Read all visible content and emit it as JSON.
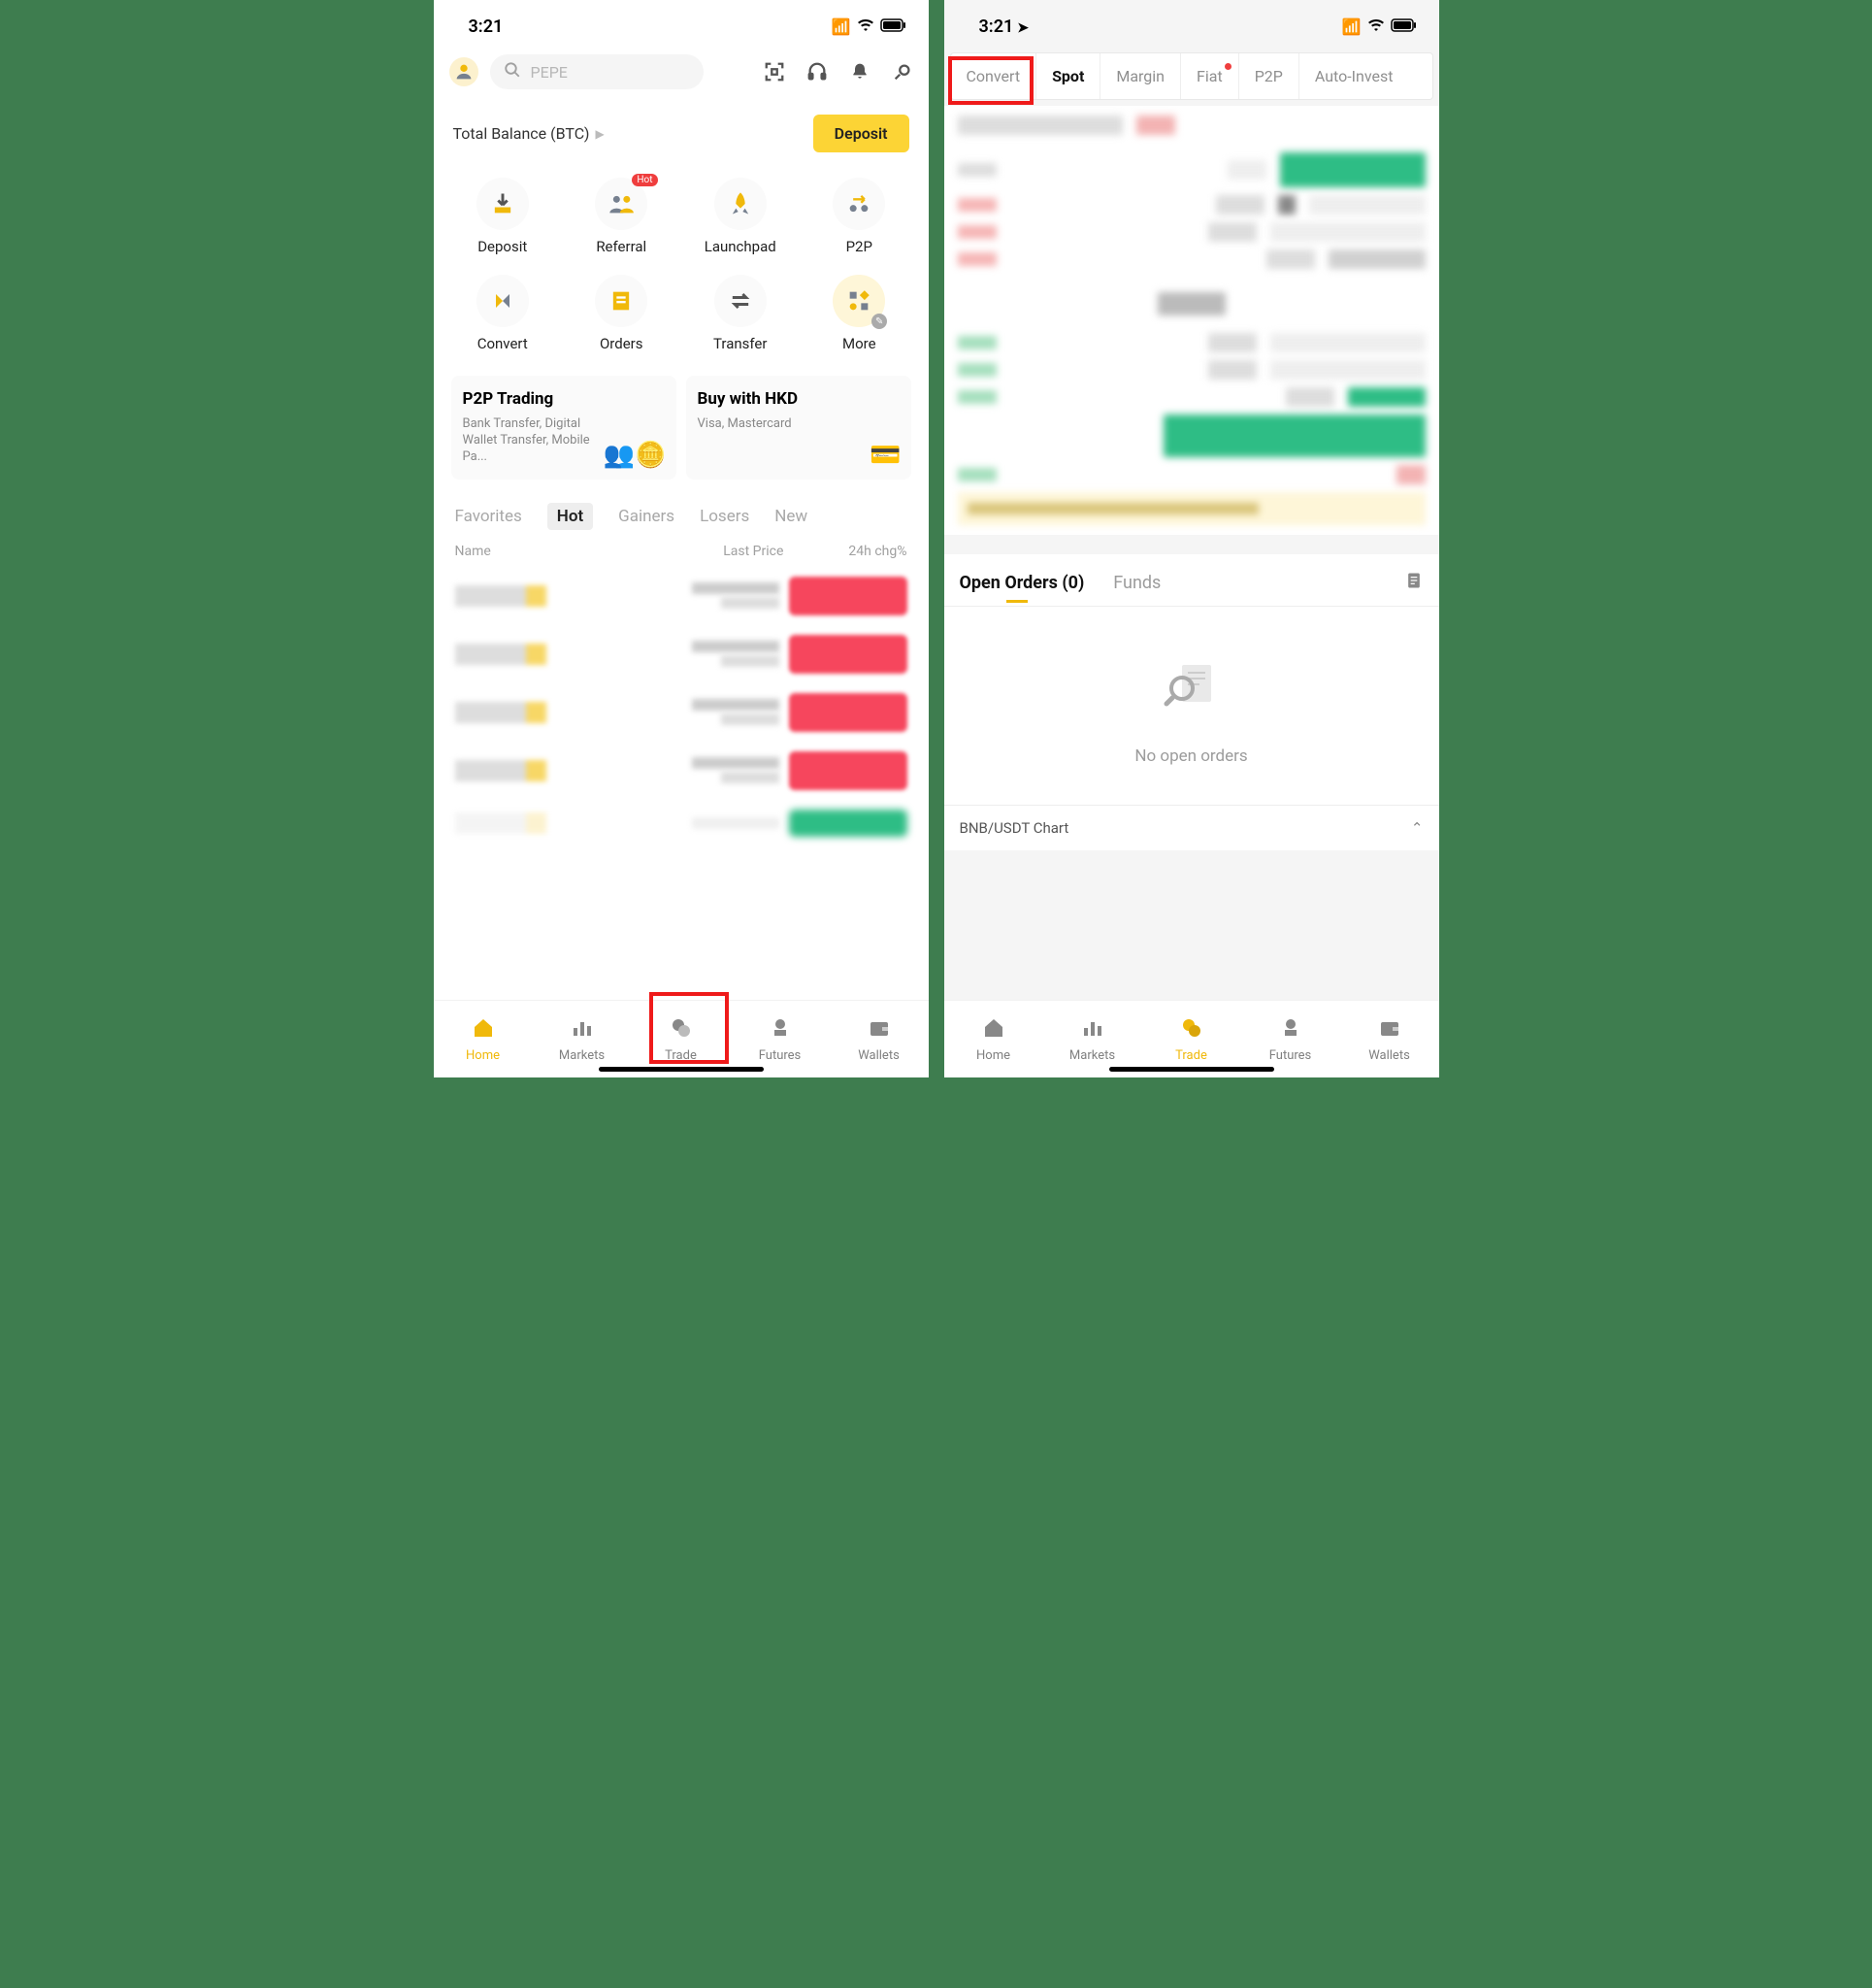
{
  "status": {
    "time": "3:21"
  },
  "left": {
    "search_placeholder": "PEPE",
    "balance_label": "Total Balance (BTC)",
    "deposit_label": "Deposit",
    "shortcuts": [
      {
        "label": "Deposit"
      },
      {
        "label": "Referral",
        "badge": "Hot"
      },
      {
        "label": "Launchpad"
      },
      {
        "label": "P2P"
      },
      {
        "label": "Convert"
      },
      {
        "label": "Orders"
      },
      {
        "label": "Transfer"
      },
      {
        "label": "More"
      }
    ],
    "cards": [
      {
        "title": "P2P Trading",
        "sub": "Bank Transfer, Digital Wallet Transfer, Mobile Pa..."
      },
      {
        "title": "Buy with HKD",
        "sub": "Visa, Mastercard"
      }
    ],
    "market_tabs": [
      "Favorites",
      "Hot",
      "Gainers",
      "Losers",
      "New"
    ],
    "market_active_tab": "Hot",
    "market_headers": {
      "name": "Name",
      "price": "Last Price",
      "chg": "24h chg%"
    },
    "nav": [
      {
        "label": "Home",
        "active": true
      },
      {
        "label": "Markets"
      },
      {
        "label": "Trade",
        "highlight": true
      },
      {
        "label": "Futures"
      },
      {
        "label": "Wallets"
      }
    ]
  },
  "right": {
    "trade_tabs": [
      "Convert",
      "Spot",
      "Margin",
      "Fiat",
      "P2P",
      "Auto-Invest"
    ],
    "trade_active_tab": "Spot",
    "trade_highlight_tab": "Convert",
    "fiat_has_dot": true,
    "orders_tab_a": "Open Orders (0)",
    "orders_tab_b": "Funds",
    "no_orders_text": "No open orders",
    "chart_label": "BNB/USDT Chart",
    "nav": [
      {
        "label": "Home"
      },
      {
        "label": "Markets"
      },
      {
        "label": "Trade",
        "active": true
      },
      {
        "label": "Futures"
      },
      {
        "label": "Wallets"
      }
    ]
  }
}
